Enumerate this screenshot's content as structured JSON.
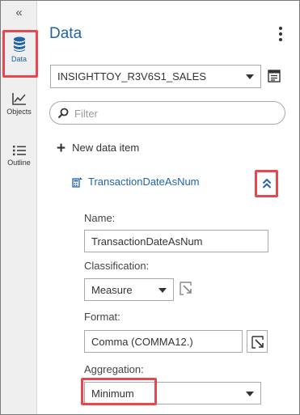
{
  "rail": {
    "collapse_glyph": "«",
    "items": [
      {
        "label": "Data",
        "icon": "database-icon",
        "active": true
      },
      {
        "label": "Objects",
        "icon": "line-chart-icon",
        "active": false
      },
      {
        "label": "Outline",
        "icon": "list-icon",
        "active": false
      }
    ]
  },
  "header": {
    "title": "Data"
  },
  "data_source": {
    "selected": "INSIGHTTOY_R3V6S1_SALES"
  },
  "filter": {
    "placeholder": "Filter",
    "value": ""
  },
  "new_item": {
    "label": "New data item"
  },
  "selected_item": {
    "name": "TransactionDateAsNum",
    "icon": "measure-icon"
  },
  "properties": {
    "name_label": "Name:",
    "name_value": "TransactionDateAsNum",
    "classification_label": "Classification:",
    "classification_value": "Measure",
    "format_label": "Format:",
    "format_value": "Comma (COMMA12.)",
    "aggregation_label": "Aggregation:",
    "aggregation_value": "Minimum"
  },
  "colors": {
    "accent": "#1f64a8",
    "highlight": "#e8474f",
    "rail_bg": "#efefef"
  }
}
